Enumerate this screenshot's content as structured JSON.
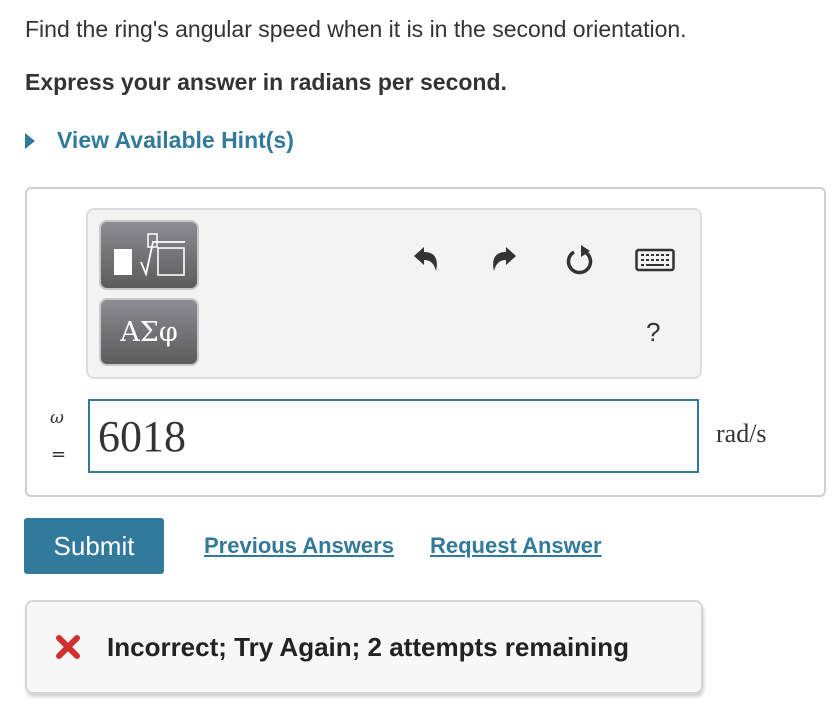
{
  "question": {
    "prompt": "Find the ring's angular speed when it is in the second orientation.",
    "instruction": "Express your answer in radians per second.",
    "hint_link": "View Available Hint(s)"
  },
  "toolbar": {
    "templates_button": "templates-icon",
    "symbols_button_label": "ΑΣφ",
    "undo": "undo-icon",
    "redo": "redo-icon",
    "reset": "reset-icon",
    "keyboard": "keyboard-icon",
    "help_label": "?"
  },
  "answer": {
    "variable": "ω",
    "equals": "=",
    "value": "6018",
    "units": "rad/s"
  },
  "actions": {
    "submit_label": "Submit",
    "previous_answers_label": "Previous Answers",
    "request_answer_label": "Request Answer"
  },
  "feedback": {
    "icon": "x-icon",
    "message": "Incorrect; Try Again; 2 attempts remaining",
    "icon_color": "#d0312d"
  },
  "colors": {
    "accent": "#327a9b",
    "error": "#d0312d"
  }
}
